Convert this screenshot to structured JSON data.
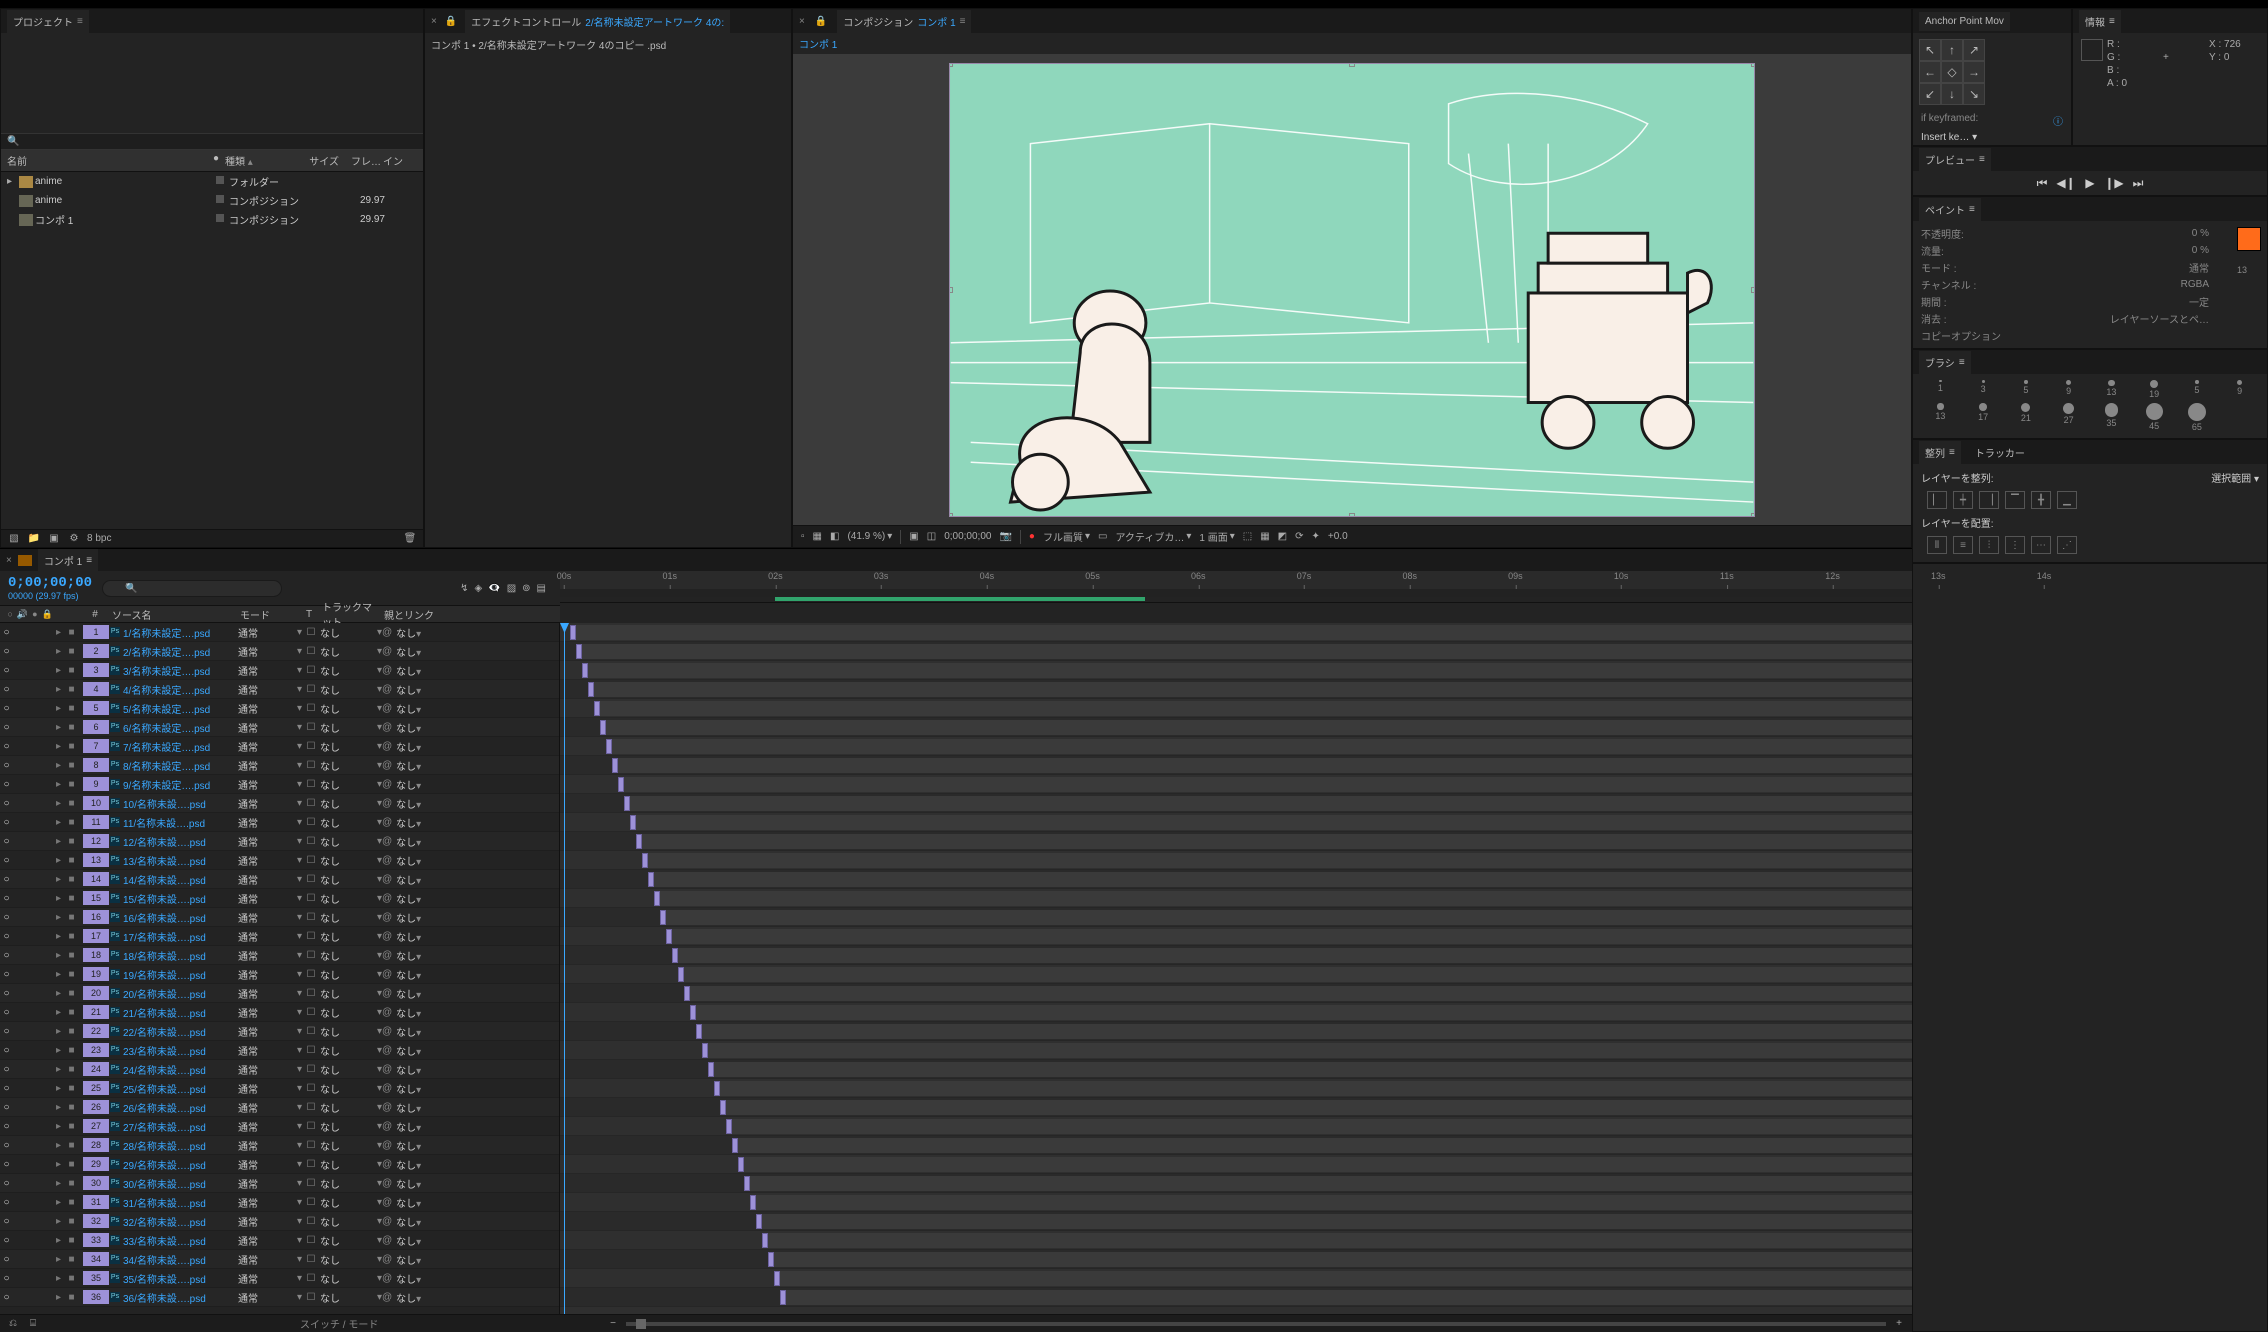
{
  "panels": {
    "project": {
      "title": "プロジェクト",
      "bpc": "8 bpc"
    },
    "effect": {
      "title": "エフェクトコントロール",
      "target": "2/名称未設定アートワーク 4の:",
      "sub": "コンポ 1 • 2/名称未設定アートワーク 4のコピー .psd"
    },
    "composition": {
      "title": "コンポジション",
      "target": "コンポ 1",
      "activeTab": "コンポ 1"
    },
    "anchor": {
      "title": "Anchor Point Mov",
      "arrows": [
        "↖",
        "↑",
        "↗",
        "←",
        "◇",
        "→",
        "↙",
        "↓",
        "↘"
      ],
      "keyframedLabel": "if keyframed:",
      "keyframedValue": "Insert ke…"
    },
    "info": {
      "title": "情報",
      "R": "",
      "G": "",
      "B": "",
      "A": "0",
      "X": "726",
      "Y": "0"
    },
    "preview": {
      "title": "プレビュー"
    },
    "paint": {
      "title": "ペイント",
      "rows": [
        {
          "k": "不透明度:",
          "v": "0 %"
        },
        {
          "k": "流量:",
          "v": "0 %"
        },
        {
          "k": "モード :",
          "v": "通常"
        },
        {
          "k": "チャンネル :",
          "v": "RGBA"
        },
        {
          "k": "期間 :",
          "v": "一定"
        },
        {
          "k": "消去 :",
          "v": "レイヤーソースとペ…"
        },
        {
          "k": "コピーオプション",
          "v": ""
        }
      ],
      "slider": "13"
    },
    "brush": {
      "title": "ブラシ",
      "sizes": [
        "1",
        "3",
        "5",
        "9",
        "13",
        "19",
        "5",
        "9",
        "13",
        "17",
        "21",
        "27",
        "35",
        "45",
        "65"
      ]
    },
    "align": {
      "title": "整列",
      "tracker": "トラッカー",
      "labelAlign": "レイヤーを整列:",
      "alignValue": "選択範囲",
      "labelDist": "レイヤーを配置:"
    }
  },
  "project_cols": {
    "name": "名前",
    "label": "●",
    "kind": "種類",
    "size": "サイズ",
    "frame": "フレ…",
    "in": "イン"
  },
  "project_items": [
    {
      "twist": "▸",
      "name": "anime",
      "kind": "フォルダー",
      "fps": "",
      "folder": true
    },
    {
      "twist": "",
      "name": "anime",
      "kind": "コンポジション",
      "fps": "29.97"
    },
    {
      "twist": "",
      "name": "コンポ 1",
      "kind": "コンポジション",
      "fps": "29.97"
    }
  ],
  "comp_toolbar": {
    "mag": "(41.9 %)",
    "time": "0;00;00;00",
    "quality": "フル画質",
    "camera": "アクティブカ…",
    "views": "1 画面",
    "exposure": "+0.0"
  },
  "timeline": {
    "tab": "コンポ 1",
    "timecode": "0;00;00;00",
    "frameinfo": "00000 (29.97 fps)",
    "seconds": [
      "00s",
      "01s",
      "02s",
      "03s",
      "04s",
      "05s",
      "06s",
      "07s",
      "08s",
      "09s",
      "10s",
      "11s",
      "12s",
      "13s",
      "14s"
    ],
    "work_start": "02s",
    "work_end": "05.5s",
    "cols": {
      "num": "#",
      "src": "ソース名",
      "mode": "モード",
      "t": "T",
      "trk": "トラックマット",
      "parent": "親とリンク"
    },
    "mode_val": "通常",
    "trk_val": "なし",
    "parent_val": "なし",
    "layers": [
      {
        "n": 1,
        "name": "1/名称未設定….psd"
      },
      {
        "n": 2,
        "name": "2/名称未設定….psd"
      },
      {
        "n": 3,
        "name": "3/名称未設定….psd"
      },
      {
        "n": 4,
        "name": "4/名称未設定….psd"
      },
      {
        "n": 5,
        "name": "5/名称未設定….psd"
      },
      {
        "n": 6,
        "name": "6/名称未設定….psd"
      },
      {
        "n": 7,
        "name": "7/名称未設定….psd"
      },
      {
        "n": 8,
        "name": "8/名称未設定….psd"
      },
      {
        "n": 9,
        "name": "9/名称未設定….psd"
      },
      {
        "n": 10,
        "name": "10/名称未設….psd"
      },
      {
        "n": 11,
        "name": "11/名称未設….psd"
      },
      {
        "n": 12,
        "name": "12/名称未設….psd"
      },
      {
        "n": 13,
        "name": "13/名称未設….psd"
      },
      {
        "n": 14,
        "name": "14/名称未設….psd"
      },
      {
        "n": 15,
        "name": "15/名称未設….psd"
      },
      {
        "n": 16,
        "name": "16/名称未設….psd"
      },
      {
        "n": 17,
        "name": "17/名称未設….psd"
      },
      {
        "n": 18,
        "name": "18/名称未設….psd"
      },
      {
        "n": 19,
        "name": "19/名称未設….psd"
      },
      {
        "n": 20,
        "name": "20/名称未設….psd"
      },
      {
        "n": 21,
        "name": "21/名称未設….psd"
      },
      {
        "n": 22,
        "name": "22/名称未設….psd"
      },
      {
        "n": 23,
        "name": "23/名称未設….psd"
      },
      {
        "n": 24,
        "name": "24/名称未設….psd"
      },
      {
        "n": 25,
        "name": "25/名称未設….psd"
      },
      {
        "n": 26,
        "name": "26/名称未設….psd"
      },
      {
        "n": 27,
        "name": "27/名称未設….psd"
      },
      {
        "n": 28,
        "name": "28/名称未設….psd"
      },
      {
        "n": 29,
        "name": "29/名称未設….psd"
      },
      {
        "n": 30,
        "name": "30/名称未設….psd"
      },
      {
        "n": 31,
        "name": "31/名称未設….psd"
      },
      {
        "n": 32,
        "name": "32/名称未設….psd"
      },
      {
        "n": 33,
        "name": "33/名称未設….psd"
      },
      {
        "n": 34,
        "name": "34/名称未設….psd"
      },
      {
        "n": 35,
        "name": "35/名称未設….psd"
      },
      {
        "n": 36,
        "name": "36/名称未設….psd"
      }
    ],
    "switch_footer": "スイッチ / モード"
  }
}
